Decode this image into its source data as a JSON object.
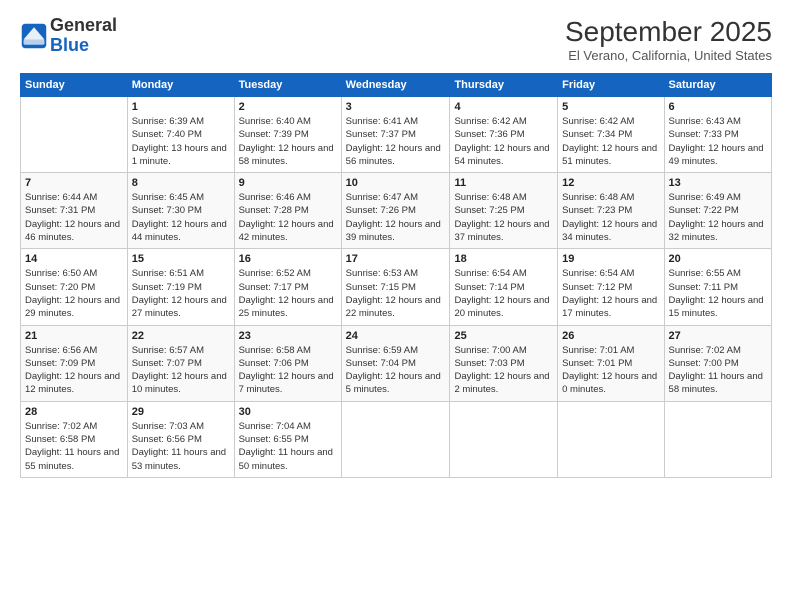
{
  "header": {
    "logo_line1": "General",
    "logo_line2": "Blue",
    "title": "September 2025",
    "subtitle": "El Verano, California, United States"
  },
  "days_of_week": [
    "Sunday",
    "Monday",
    "Tuesday",
    "Wednesday",
    "Thursday",
    "Friday",
    "Saturday"
  ],
  "weeks": [
    [
      {
        "day": "",
        "info": ""
      },
      {
        "day": "1",
        "info": "Sunrise: 6:39 AM\nSunset: 7:40 PM\nDaylight: 13 hours\nand 1 minute."
      },
      {
        "day": "2",
        "info": "Sunrise: 6:40 AM\nSunset: 7:39 PM\nDaylight: 12 hours\nand 58 minutes."
      },
      {
        "day": "3",
        "info": "Sunrise: 6:41 AM\nSunset: 7:37 PM\nDaylight: 12 hours\nand 56 minutes."
      },
      {
        "day": "4",
        "info": "Sunrise: 6:42 AM\nSunset: 7:36 PM\nDaylight: 12 hours\nand 54 minutes."
      },
      {
        "day": "5",
        "info": "Sunrise: 6:42 AM\nSunset: 7:34 PM\nDaylight: 12 hours\nand 51 minutes."
      },
      {
        "day": "6",
        "info": "Sunrise: 6:43 AM\nSunset: 7:33 PM\nDaylight: 12 hours\nand 49 minutes."
      }
    ],
    [
      {
        "day": "7",
        "info": "Sunrise: 6:44 AM\nSunset: 7:31 PM\nDaylight: 12 hours\nand 46 minutes."
      },
      {
        "day": "8",
        "info": "Sunrise: 6:45 AM\nSunset: 7:30 PM\nDaylight: 12 hours\nand 44 minutes."
      },
      {
        "day": "9",
        "info": "Sunrise: 6:46 AM\nSunset: 7:28 PM\nDaylight: 12 hours\nand 42 minutes."
      },
      {
        "day": "10",
        "info": "Sunrise: 6:47 AM\nSunset: 7:26 PM\nDaylight: 12 hours\nand 39 minutes."
      },
      {
        "day": "11",
        "info": "Sunrise: 6:48 AM\nSunset: 7:25 PM\nDaylight: 12 hours\nand 37 minutes."
      },
      {
        "day": "12",
        "info": "Sunrise: 6:48 AM\nSunset: 7:23 PM\nDaylight: 12 hours\nand 34 minutes."
      },
      {
        "day": "13",
        "info": "Sunrise: 6:49 AM\nSunset: 7:22 PM\nDaylight: 12 hours\nand 32 minutes."
      }
    ],
    [
      {
        "day": "14",
        "info": "Sunrise: 6:50 AM\nSunset: 7:20 PM\nDaylight: 12 hours\nand 29 minutes."
      },
      {
        "day": "15",
        "info": "Sunrise: 6:51 AM\nSunset: 7:19 PM\nDaylight: 12 hours\nand 27 minutes."
      },
      {
        "day": "16",
        "info": "Sunrise: 6:52 AM\nSunset: 7:17 PM\nDaylight: 12 hours\nand 25 minutes."
      },
      {
        "day": "17",
        "info": "Sunrise: 6:53 AM\nSunset: 7:15 PM\nDaylight: 12 hours\nand 22 minutes."
      },
      {
        "day": "18",
        "info": "Sunrise: 6:54 AM\nSunset: 7:14 PM\nDaylight: 12 hours\nand 20 minutes."
      },
      {
        "day": "19",
        "info": "Sunrise: 6:54 AM\nSunset: 7:12 PM\nDaylight: 12 hours\nand 17 minutes."
      },
      {
        "day": "20",
        "info": "Sunrise: 6:55 AM\nSunset: 7:11 PM\nDaylight: 12 hours\nand 15 minutes."
      }
    ],
    [
      {
        "day": "21",
        "info": "Sunrise: 6:56 AM\nSunset: 7:09 PM\nDaylight: 12 hours\nand 12 minutes."
      },
      {
        "day": "22",
        "info": "Sunrise: 6:57 AM\nSunset: 7:07 PM\nDaylight: 12 hours\nand 10 minutes."
      },
      {
        "day": "23",
        "info": "Sunrise: 6:58 AM\nSunset: 7:06 PM\nDaylight: 12 hours\nand 7 minutes."
      },
      {
        "day": "24",
        "info": "Sunrise: 6:59 AM\nSunset: 7:04 PM\nDaylight: 12 hours\nand 5 minutes."
      },
      {
        "day": "25",
        "info": "Sunrise: 7:00 AM\nSunset: 7:03 PM\nDaylight: 12 hours\nand 2 minutes."
      },
      {
        "day": "26",
        "info": "Sunrise: 7:01 AM\nSunset: 7:01 PM\nDaylight: 12 hours\nand 0 minutes."
      },
      {
        "day": "27",
        "info": "Sunrise: 7:02 AM\nSunset: 7:00 PM\nDaylight: 11 hours\nand 58 minutes."
      }
    ],
    [
      {
        "day": "28",
        "info": "Sunrise: 7:02 AM\nSunset: 6:58 PM\nDaylight: 11 hours\nand 55 minutes."
      },
      {
        "day": "29",
        "info": "Sunrise: 7:03 AM\nSunset: 6:56 PM\nDaylight: 11 hours\nand 53 minutes."
      },
      {
        "day": "30",
        "info": "Sunrise: 7:04 AM\nSunset: 6:55 PM\nDaylight: 11 hours\nand 50 minutes."
      },
      {
        "day": "",
        "info": ""
      },
      {
        "day": "",
        "info": ""
      },
      {
        "day": "",
        "info": ""
      },
      {
        "day": "",
        "info": ""
      }
    ]
  ]
}
